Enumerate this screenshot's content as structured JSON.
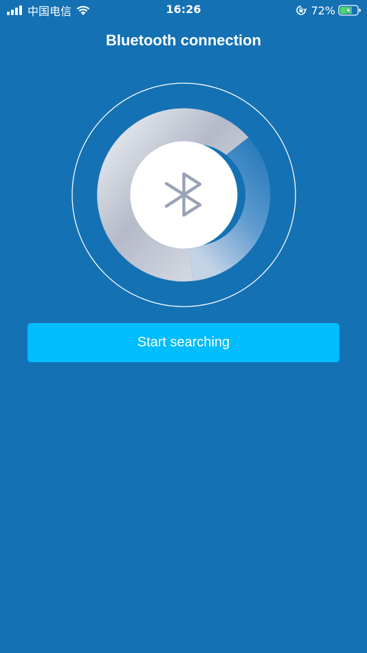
{
  "status_bar": {
    "carrier": "中国电信",
    "time": "16:26",
    "battery_percent": "72%",
    "signal_bars": 4,
    "icons": [
      "signal-icon",
      "wifi-icon",
      "orientation-lock-icon",
      "battery-charging-icon"
    ],
    "battery_fill_color": "#4cd964"
  },
  "header": {
    "title": "Bluetooth connection"
  },
  "scanner": {
    "icon": "bluetooth-icon",
    "ring_color": "#ffffff",
    "icon_color": "#9aa3b6"
  },
  "actions": {
    "start_label": "Start searching"
  },
  "colors": {
    "background": "#1471b4",
    "button": "#00bdfd"
  }
}
